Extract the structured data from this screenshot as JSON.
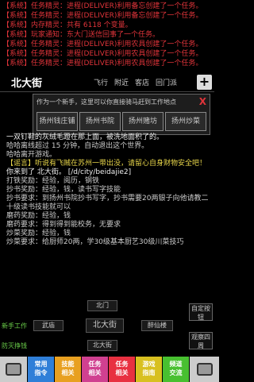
{
  "system_messages": [
    "【系统】任务精灵：进程(DELIVER)利用备忘创建了一个任务。",
    "【系统】任务精灵：进程(DELIVER)利用备忘创建了一个任务。",
    "【系统】内存精灵：共有 6118 个变量。",
    "【系统】玩家通知：东大门送信回事了一个任务。",
    "【系统】任务精灵：进程(DELIVER)利用农具创建了一个任务。",
    "【系统】任务精灵：进程(DELIVER)利用农具创建了一个任务。",
    "【系统】任务精灵：进程(DELIVER)利用农具创建了一个任务。"
  ],
  "location": {
    "name": "北大街",
    "actions": [
      "飞行",
      "附近",
      "客店",
      "回门派"
    ],
    "plus": "+"
  },
  "popup": {
    "text": "作为一个新手，这里可以你直接骑马赶到工作地点",
    "close": "X",
    "buttons": [
      "扬州钱庄铺",
      "扬州书院",
      "扬州赌坊",
      "扬州炒菜"
    ]
  },
  "log": [
    {
      "t": "一双钉鞋的灰绒毛蹬在那上面，被洗地面积了的。",
      "c": "white"
    },
    {
      "t": "哈哈离线超过 15 分钟，自动退出这个世界。",
      "c": "gray"
    },
    {
      "t": "哈哈离开游戏。",
      "c": "gray"
    },
    {
      "t": "【谣言】听说有飞贼在苏州一带出没，请留心自身财物安全吧！",
      "c": "yellow"
    },
    {
      "t": "你来到了 北大街。      [/d/city/beidajie2]",
      "c": "white"
    },
    {
      "t": "打铁奖励：经验，阅历，钢铁",
      "c": "gray"
    },
    {
      "t": "抄书奖励：经验，钱，读书写字技能",
      "c": "gray"
    },
    {
      "t": "抄书要求：到扬州书院抄书写字，抄书需要20两银子向他请教二十级读书技能就可以",
      "c": "gray"
    },
    {
      "t": "磨药奖励：经验，钱",
      "c": "gray"
    },
    {
      "t": "磨药要求：得到得到能校务，无要求",
      "c": "gray"
    },
    {
      "t": "炒菜奖励：经验，钱",
      "c": "gray"
    },
    {
      "t": "炒菜要求：给厨师20两，学30级基本厨艺30级川菜技巧",
      "c": "gray"
    }
  ],
  "map": {
    "north": "北门",
    "west": "武庙",
    "center": "北大街",
    "east": "醉仙楼",
    "south": "北大街"
  },
  "side": {
    "new_job": "新手工作",
    "anti_flush": "防灭挣钱",
    "custom_btn": "自定按钮",
    "observe": "观察四周"
  },
  "toolbar": [
    {
      "label1": "",
      "label2": "",
      "color": "#cccccc",
      "name": "menu"
    },
    {
      "label1": "常用",
      "label2": "指令",
      "color": "#2f7fd8",
      "name": "common"
    },
    {
      "label1": "技能",
      "label2": "相关",
      "color": "#e8a020",
      "name": "skills"
    },
    {
      "label1": "任务",
      "label2": "相关",
      "color": "#d04090",
      "name": "quests"
    },
    {
      "label1": "任务",
      "label2": "相关",
      "color": "#e83040",
      "name": "quests2"
    },
    {
      "label1": "游戏",
      "label2": "指南",
      "color": "#d8c020",
      "name": "guide"
    },
    {
      "label1": "频道",
      "label2": "交流",
      "color": "#48c030",
      "name": "channel"
    },
    {
      "label1": "",
      "label2": "",
      "color": "#cccccc",
      "name": "chat"
    }
  ]
}
